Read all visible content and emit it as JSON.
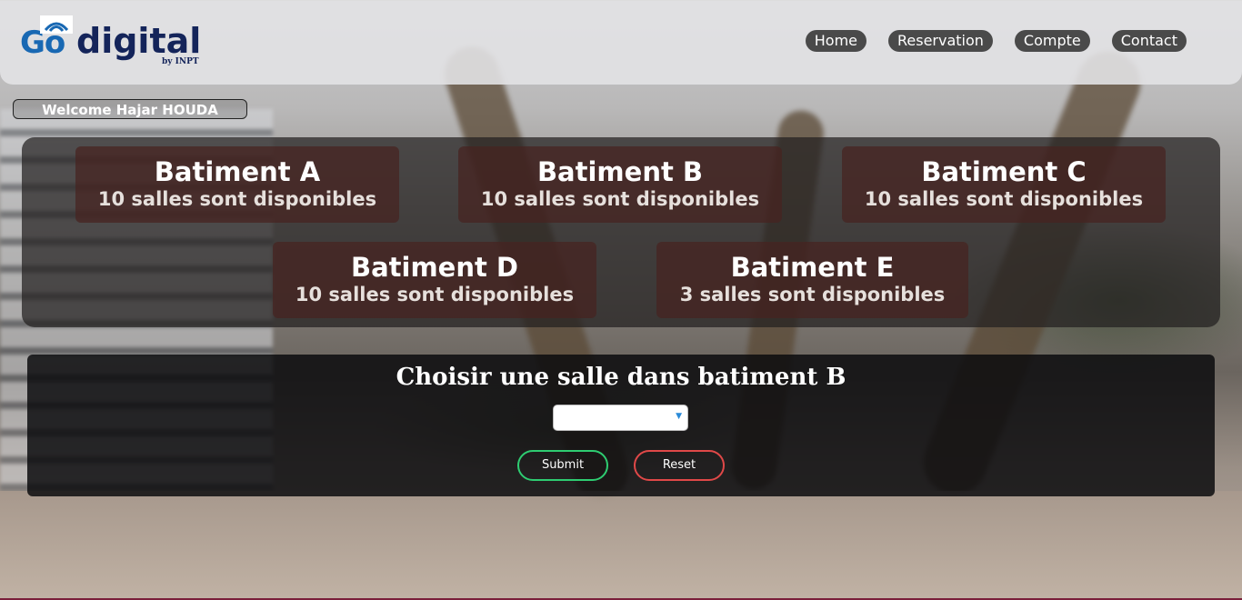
{
  "logo": {
    "go": "Go",
    "digital": "digital",
    "by": "by INPT"
  },
  "nav": [
    "Home",
    "Reservation",
    "Compte",
    "Contact"
  ],
  "welcome": "Welcome Hajar HOUDA",
  "buildings": [
    {
      "name": "Batiment A",
      "availability": "10 salles sont disponibles"
    },
    {
      "name": "Batiment B",
      "availability": "10 salles sont disponibles"
    },
    {
      "name": "Batiment C",
      "availability": "10 salles sont disponibles"
    },
    {
      "name": "Batiment D",
      "availability": "10 salles sont disponibles"
    },
    {
      "name": "Batiment E",
      "availability": "3 salles sont disponibles"
    }
  ],
  "form": {
    "title": "Choisir une salle dans batiment B",
    "select_value": "",
    "submit_label": "Submit",
    "reset_label": "Reset"
  },
  "colors": {
    "submit_border": "#2ecc71",
    "reset_border": "#e04848",
    "logo_blue": "#1868b3",
    "logo_navy": "#14245a"
  }
}
